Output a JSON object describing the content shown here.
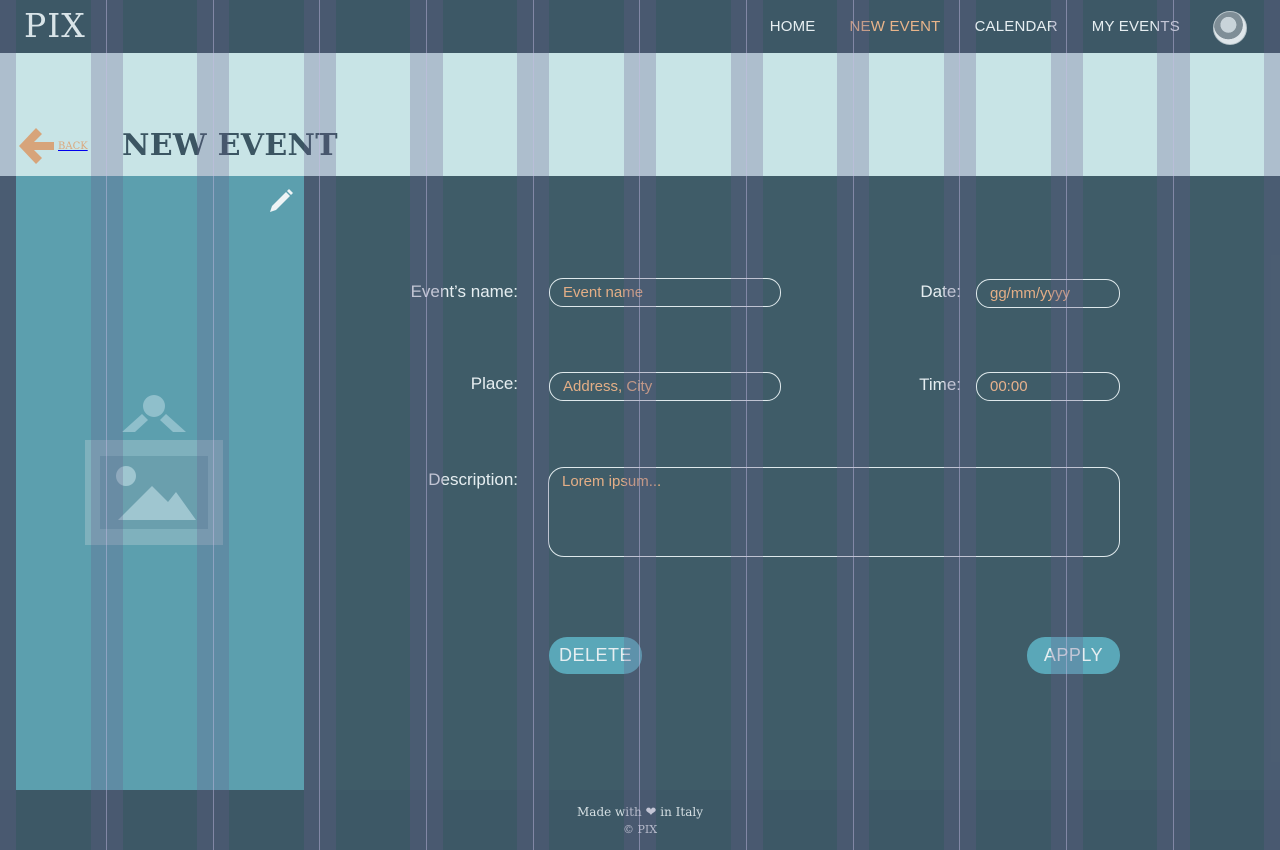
{
  "app": {
    "logo": "PIX"
  },
  "nav": {
    "items": [
      {
        "label": "HOME",
        "active": false
      },
      {
        "label": "NEW EVENT",
        "active": true
      },
      {
        "label": "CALENDAR",
        "active": false
      },
      {
        "label": "MY EVENTS",
        "active": false
      }
    ]
  },
  "header": {
    "back_label": "BACK",
    "title": "NEW EVENT"
  },
  "form": {
    "name_label": "Event’s name:",
    "name_placeholder": "Event name",
    "date_label": "Date:",
    "date_placeholder": "gg/mm/yyyy",
    "place_label": "Place:",
    "place_placeholder": "Address, City",
    "time_label": "Time:",
    "time_value": "00:00",
    "description_label": "Description:",
    "description_placeholder": "Lorem ipsum..."
  },
  "actions": {
    "delete_label": "DELETE",
    "apply_label": "APPLY"
  },
  "footer": {
    "made_prefix": "Made with",
    "heart": "❤",
    "made_suffix": "in Italy",
    "copyright": "© PIX"
  },
  "icons": {
    "back": "arrow-left-icon",
    "edit": "pencil-icon",
    "placeholder": "image-placeholder-icon",
    "avatar": "user-avatar"
  },
  "colors": {
    "topbar": "#3d5866",
    "header_band": "#c8e4e6",
    "main_bg": "#3f5c68",
    "image_panel": "#5c9fae",
    "accent": "#e8b48a",
    "button": "#5aa7b8"
  }
}
